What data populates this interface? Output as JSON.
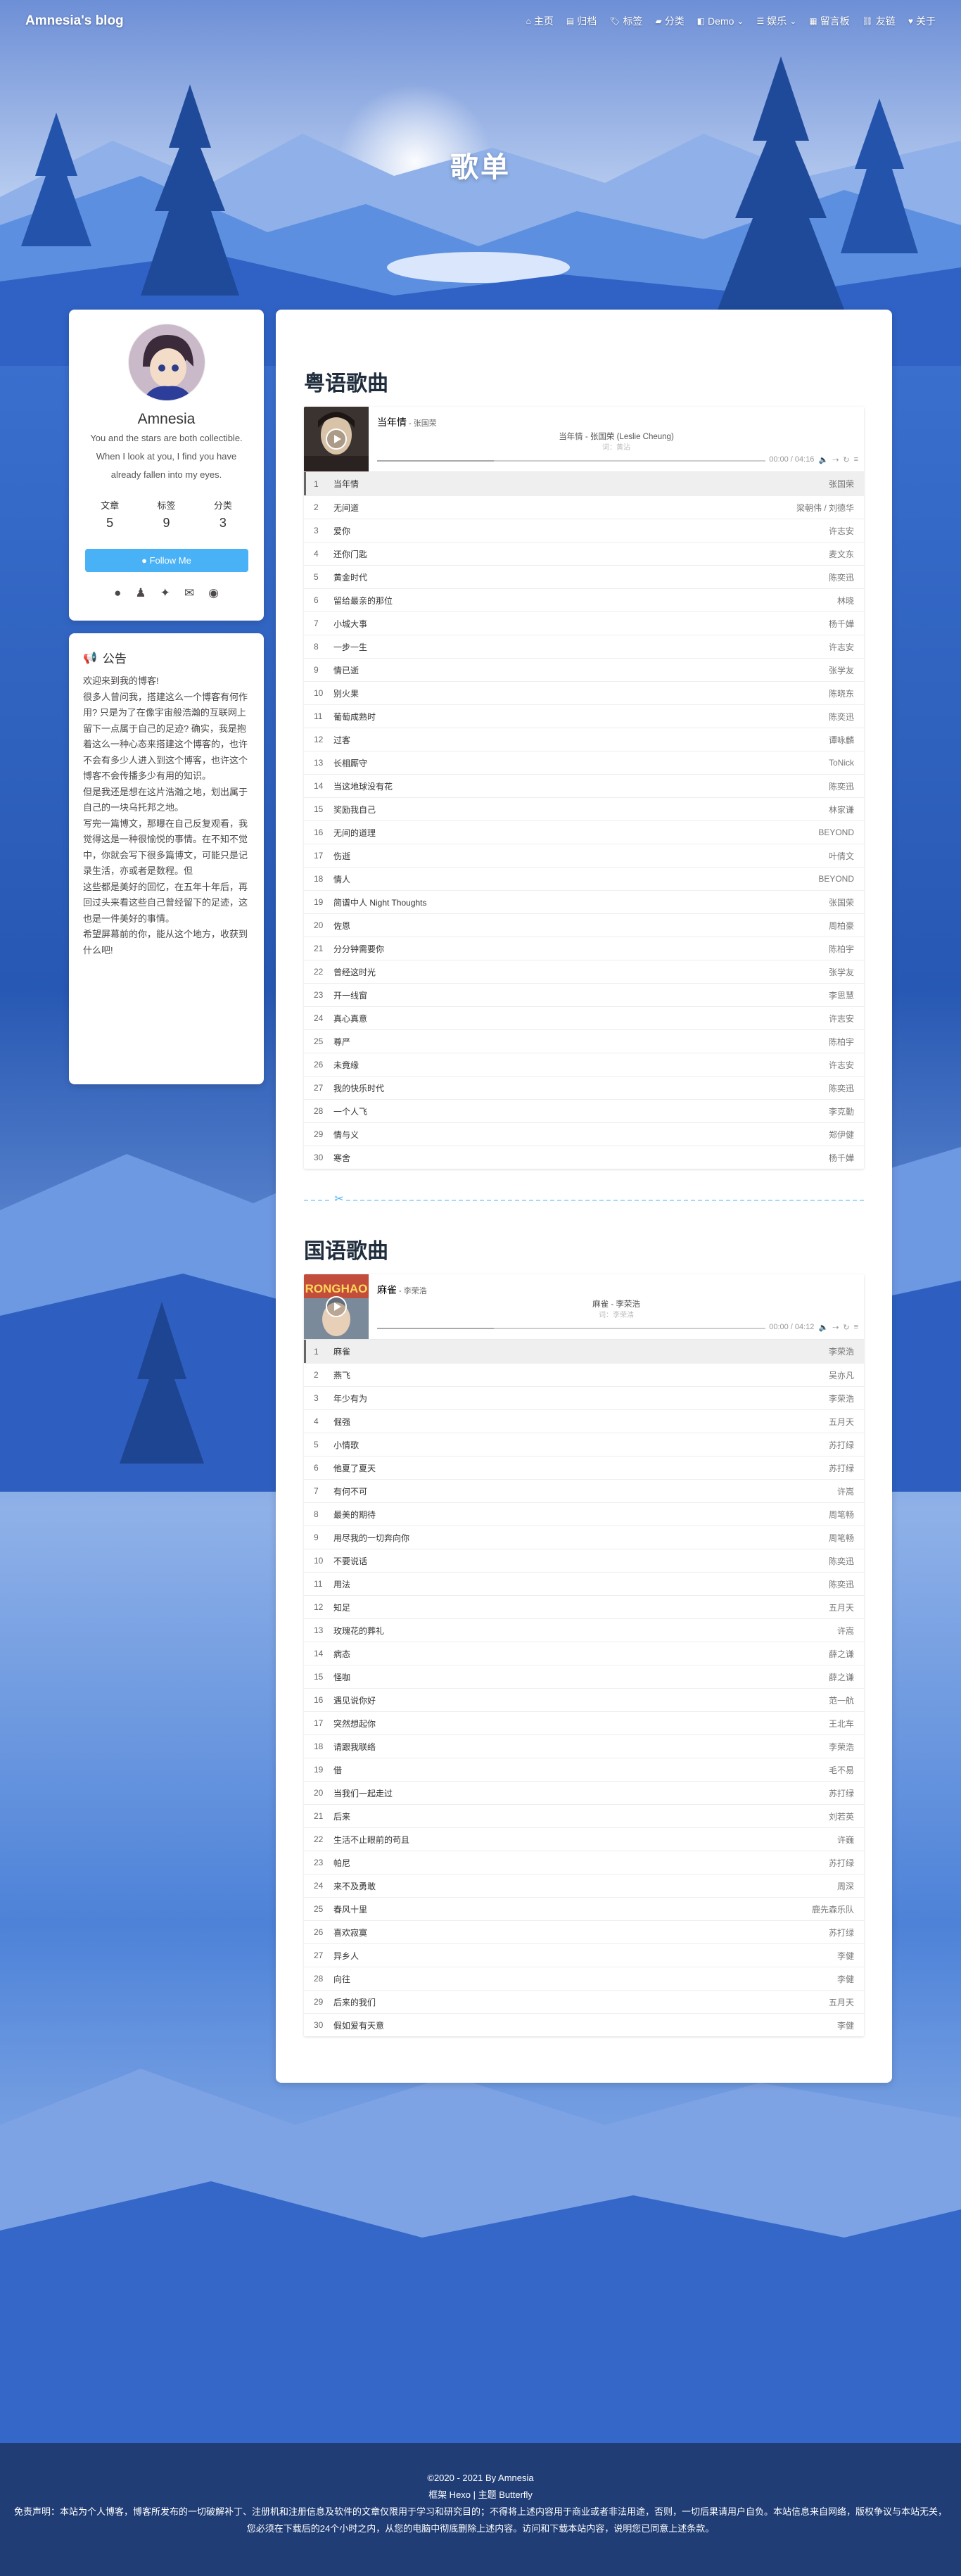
{
  "nav": {
    "site_name": "Amnesia's blog",
    "items": [
      {
        "label": "主页",
        "icon": "home-icon",
        "glyph": "⌂"
      },
      {
        "label": "归档",
        "icon": "archive-icon",
        "glyph": "▤"
      },
      {
        "label": "标签",
        "icon": "tags-icon",
        "glyph": "🏷"
      },
      {
        "label": "分类",
        "icon": "folder-icon",
        "glyph": "▰"
      },
      {
        "label": "Demo",
        "icon": "demo-icon",
        "glyph": "◧",
        "dropdown": true
      },
      {
        "label": "娱乐",
        "icon": "list-icon",
        "glyph": "☰",
        "dropdown": true
      },
      {
        "label": "留言板",
        "icon": "message-board-icon",
        "glyph": "▦"
      },
      {
        "label": "友链",
        "icon": "link-icon",
        "glyph": "⛓"
      },
      {
        "label": "关于",
        "icon": "heart-icon",
        "glyph": "♥"
      }
    ]
  },
  "page_title": "歌单",
  "author": {
    "name": "Amnesia",
    "desc": "You and the stars are both collectible. When I look at you, I find you have already fallen into my eyes.",
    "stats": [
      {
        "label": "文章",
        "value": "5"
      },
      {
        "label": "标签",
        "value": "9"
      },
      {
        "label": "分类",
        "value": "3"
      }
    ],
    "follow_label": "Follow Me",
    "socials": [
      "github-icon",
      "qq-icon",
      "twitter-icon",
      "email-icon",
      "rss-icon"
    ]
  },
  "notice": {
    "title": "公告",
    "body": "欢迎来到我的博客!\n很多人曾问我，搭建这么一个博客有何作用? 只是为了在像宇宙般浩瀚的互联网上留下一点属于自己的足迹? 确实，我是抱着这么一种心态来搭建这个博客的，也许不会有多少人进入到这个博客，也许这个博客不会传播多少有用的知识。\n但是我还是想在这片浩瀚之地，划出属于自己的一块乌托邦之地。\n写完一篇博文，那曝在自己反复观看，我觉得这是一种很愉悦的事情。在不知不觉中，你就会写下很多篇博文，可能只是记录生活，亦或者是数程。但\n这些都是美好的回忆，在五年十年后，再回过头来看这些自己曾经留下的足迹，这也是一件美好的事情。\n希望屏幕前的你，能从这个地方，收获到什么吧!"
  },
  "sections": [
    {
      "title": "粤语歌曲",
      "player": {
        "title": "当年情",
        "artist": " - 张国荣",
        "lyric": "当年情 - 张国荣 (Leslie Cheung)",
        "lyric_sub": "词：黄沾",
        "time": "00:00 / 04:16"
      },
      "songs": [
        {
          "t": "当年情",
          "a": "张国荣"
        },
        {
          "t": "无间道",
          "a": "梁朝伟 / 刘德华"
        },
        {
          "t": "爱你",
          "a": "许志安"
        },
        {
          "t": "还你门匙",
          "a": "麦文东"
        },
        {
          "t": "黄金时代",
          "a": "陈奕迅"
        },
        {
          "t": "留给最亲的那位",
          "a": "林晓"
        },
        {
          "t": "小城大事",
          "a": "杨千嬅"
        },
        {
          "t": "一步一生",
          "a": "许志安"
        },
        {
          "t": "情已逝",
          "a": "张学友"
        },
        {
          "t": "别火果",
          "a": "陈晓东"
        },
        {
          "t": "葡萄成熟时",
          "a": "陈奕迅"
        },
        {
          "t": "过客",
          "a": "谭咏麟"
        },
        {
          "t": "长相厮守",
          "a": "ToNick"
        },
        {
          "t": "当这地球没有花",
          "a": "陈奕迅"
        },
        {
          "t": "奖励我自己",
          "a": "林家谦"
        },
        {
          "t": "无间的道理",
          "a": "BEYOND"
        },
        {
          "t": "伤逝",
          "a": "叶倩文"
        },
        {
          "t": "情人",
          "a": "BEYOND"
        },
        {
          "t": "简谱中人 Night Thoughts",
          "a": "张国荣"
        },
        {
          "t": "佐恩",
          "a": "周柏豪"
        },
        {
          "t": "分分钟需要你",
          "a": "陈柏宇"
        },
        {
          "t": "曾经这时光",
          "a": "张学友"
        },
        {
          "t": "开一线窗",
          "a": "李思慧"
        },
        {
          "t": "真心真意",
          "a": "许志安"
        },
        {
          "t": "尊严",
          "a": "陈柏宇"
        },
        {
          "t": "未竟缘",
          "a": "许志安"
        },
        {
          "t": "我的快乐时代",
          "a": "陈奕迅"
        },
        {
          "t": "一个人飞",
          "a": "李克勤"
        },
        {
          "t": "情与义",
          "a": "郑伊健"
        },
        {
          "t": "寒舍",
          "a": "杨千嬅"
        }
      ]
    },
    {
      "title": "国语歌曲",
      "player": {
        "title": "麻雀",
        "artist": " - 李荣浩",
        "lyric": "麻雀 - 李荣浩",
        "lyric_sub": "词：李荣浩",
        "time": "00:00 / 04:12"
      },
      "songs": [
        {
          "t": "麻雀",
          "a": "李荣浩"
        },
        {
          "t": "燕飞",
          "a": "吴亦凡"
        },
        {
          "t": "年少有为",
          "a": "李荣浩"
        },
        {
          "t": "倔强",
          "a": "五月天"
        },
        {
          "t": "小情歌",
          "a": "苏打绿"
        },
        {
          "t": "他夏了夏天",
          "a": "苏打绿"
        },
        {
          "t": "有何不可",
          "a": "许嵩"
        },
        {
          "t": "最美的期待",
          "a": "周笔畅"
        },
        {
          "t": "用尽我的一切奔向你",
          "a": "周笔畅"
        },
        {
          "t": "不要说话",
          "a": "陈奕迅"
        },
        {
          "t": "用法",
          "a": "陈奕迅"
        },
        {
          "t": "知足",
          "a": "五月天"
        },
        {
          "t": "玫瑰花的葬礼",
          "a": "许嵩"
        },
        {
          "t": "病态",
          "a": "薛之谦"
        },
        {
          "t": "怪咖",
          "a": "薛之谦"
        },
        {
          "t": "遇见说你好",
          "a": "范一航"
        },
        {
          "t": "突然想起你",
          "a": "王北车"
        },
        {
          "t": "请跟我联络",
          "a": "李荣浩"
        },
        {
          "t": "借",
          "a": "毛不易"
        },
        {
          "t": "当我们一起走过",
          "a": "苏打绿"
        },
        {
          "t": "后来",
          "a": "刘若英"
        },
        {
          "t": "生活不止眼前的苟且",
          "a": "许巍"
        },
        {
          "t": "帕尼",
          "a": "苏打绿"
        },
        {
          "t": "来不及勇敢",
          "a": "周深"
        },
        {
          "t": "春风十里",
          "a": "鹿先森乐队"
        },
        {
          "t": "喜欢寂寞",
          "a": "苏打绿"
        },
        {
          "t": "异乡人",
          "a": "李健"
        },
        {
          "t": "向往",
          "a": "李健"
        },
        {
          "t": "后来的我们",
          "a": "五月天"
        },
        {
          "t": "假如爱有天意",
          "a": "李健"
        }
      ]
    }
  ],
  "footer": {
    "copyright": "©2020 - 2021 By Amnesia",
    "framework": "框架 Hexo | 主题 Butterfly",
    "disclaimer": "免责声明：本站为个人博客，博客所发布的一切破解补丁、注册机和注册信息及软件的文章仅限用于学习和研究目的；不得将上述内容用于商业或者非法用途，否则，一切后果请用户自负。本站信息来自网络，版权争议与本站无关，您必须在下载后的24个小时之内，从您的电脑中彻底删除上述内容。访问和下载本站内容，说明您已同意上述条款。"
  }
}
